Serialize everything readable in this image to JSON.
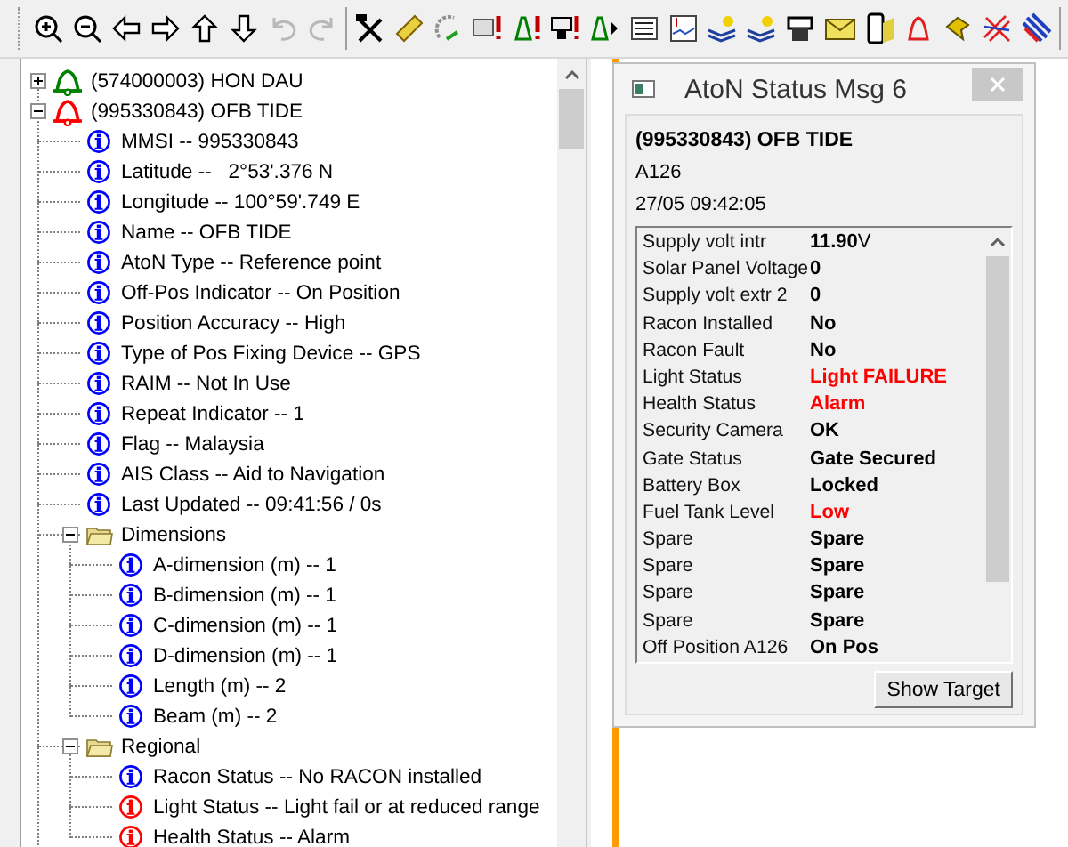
{
  "toolbar": {
    "groups": [
      [
        {
          "kind": "zoom-in",
          "disabled": false
        },
        {
          "kind": "zoom-out",
          "disabled": false
        },
        {
          "kind": "left",
          "disabled": false
        },
        {
          "kind": "right",
          "disabled": false
        },
        {
          "kind": "up",
          "disabled": false
        },
        {
          "kind": "down",
          "disabled": false
        },
        {
          "kind": "undo",
          "disabled": true
        },
        {
          "kind": "redo",
          "disabled": true
        }
      ],
      [
        {
          "kind": "tools",
          "disabled": false
        },
        {
          "kind": "ruler",
          "disabled": false
        },
        {
          "kind": "dish",
          "disabled": false
        },
        {
          "kind": "table-alert",
          "disabled": false
        },
        {
          "kind": "beacon-alert",
          "disabled": false
        },
        {
          "kind": "monitor-alert",
          "disabled": false
        },
        {
          "kind": "beacon-signal",
          "disabled": false
        },
        {
          "kind": "list",
          "disabled": false
        },
        {
          "kind": "chart",
          "disabled": false
        },
        {
          "kind": "layers-sun",
          "disabled": false
        },
        {
          "kind": "layers-sun",
          "disabled": false
        },
        {
          "kind": "printer",
          "disabled": false
        },
        {
          "kind": "envelope",
          "disabled": false
        },
        {
          "kind": "phone",
          "disabled": false
        },
        {
          "kind": "bell",
          "disabled": false
        },
        {
          "kind": "pin",
          "disabled": false
        },
        {
          "kind": "crossed-lines",
          "disabled": false
        },
        {
          "kind": "stripes",
          "disabled": false
        }
      ]
    ]
  },
  "tree": [
    {
      "label": "(574000003) HON DAU",
      "kind": "bell",
      "color": "#008000",
      "expanded": false
    },
    {
      "label": "(995330843) OFB TIDE",
      "kind": "bell",
      "color": "#ff0000",
      "expanded": true,
      "children": [
        {
          "label": "MMSI -- 995330843",
          "kind": "info",
          "color": "#0000ff"
        },
        {
          "label": "Latitude --   2°53'.376 N",
          "kind": "info",
          "color": "#0000ff"
        },
        {
          "label": "Longitude -- 100°59'.749 E",
          "kind": "info",
          "color": "#0000ff"
        },
        {
          "label": "Name -- OFB TIDE",
          "kind": "info",
          "color": "#0000ff"
        },
        {
          "label": "AtoN Type -- Reference point",
          "kind": "info",
          "color": "#0000ff"
        },
        {
          "label": "Off-Pos Indicator -- On Position",
          "kind": "info",
          "color": "#0000ff"
        },
        {
          "label": "Position Accuracy -- High",
          "kind": "info",
          "color": "#0000ff"
        },
        {
          "label": "Type of Pos Fixing Device -- GPS",
          "kind": "info",
          "color": "#0000ff"
        },
        {
          "label": "RAIM -- Not In Use",
          "kind": "info",
          "color": "#0000ff"
        },
        {
          "label": "Repeat Indicator -- 1",
          "kind": "info",
          "color": "#0000ff"
        },
        {
          "label": "Flag -- Malaysia",
          "kind": "info",
          "color": "#0000ff"
        },
        {
          "label": "AIS Class -- Aid to Navigation",
          "kind": "info",
          "color": "#0000ff"
        },
        {
          "label": "Last Updated -- 09:41:56 / 0s",
          "kind": "info",
          "color": "#0000ff"
        },
        {
          "label": "Dimensions",
          "kind": "folder",
          "expanded": true,
          "children": [
            {
              "label": "A-dimension (m) -- 1",
              "kind": "info",
              "color": "#0000ff"
            },
            {
              "label": "B-dimension (m) -- 1",
              "kind": "info",
              "color": "#0000ff"
            },
            {
              "label": "C-dimension (m) -- 1",
              "kind": "info",
              "color": "#0000ff"
            },
            {
              "label": "D-dimension (m) -- 1",
              "kind": "info",
              "color": "#0000ff"
            },
            {
              "label": "Length (m) -- 2",
              "kind": "info",
              "color": "#0000ff"
            },
            {
              "label": "Beam (m) -- 2",
              "kind": "info",
              "color": "#0000ff"
            }
          ]
        },
        {
          "label": "Regional",
          "kind": "folder",
          "expanded": true,
          "children": [
            {
              "label": "Racon Status -- No RACON installed",
              "kind": "info",
              "color": "#0000ff"
            },
            {
              "label": "Light Status -- Light fail or at reduced range",
              "kind": "info",
              "color": "#ff0000"
            },
            {
              "label": "Health Status -- Alarm",
              "kind": "info",
              "color": "#ff0000"
            }
          ]
        }
      ]
    }
  ],
  "dialog": {
    "title": "AtoN Status Msg 6",
    "target": "(995330843) OFB TIDE",
    "station": "A126",
    "time": "27/05 09:42:05",
    "rows": [
      {
        "label": "Supply volt intr",
        "value": "11.90",
        "unit": "V",
        "alert": false
      },
      {
        "label": "Solar Panel Voltage",
        "value": "0",
        "alert": false
      },
      {
        "label": "Supply volt extr 2",
        "value": "0",
        "alert": false
      },
      {
        "label": "Racon Installed",
        "value": "No",
        "alert": false
      },
      {
        "label": "Racon Fault",
        "value": "No",
        "alert": false
      },
      {
        "label": "Light Status",
        "value": "Light FAILURE",
        "alert": true
      },
      {
        "label": "Health Status",
        "value": "Alarm",
        "alert": true
      },
      {
        "label": "Security Camera",
        "value": "OK",
        "alert": false
      },
      {
        "label": "Gate Status",
        "value": "Gate Secured",
        "alert": false
      },
      {
        "label": "Battery Box",
        "value": "Locked",
        "alert": false
      },
      {
        "label": "Fuel Tank Level",
        "value": "Low",
        "alert": true
      },
      {
        "label": "Spare",
        "value": "Spare",
        "alert": false
      },
      {
        "label": "Spare",
        "value": "Spare",
        "alert": false
      },
      {
        "label": "Spare",
        "value": "Spare",
        "alert": false
      },
      {
        "label": "Spare",
        "value": "Spare",
        "alert": false
      },
      {
        "label": "Off Position A126",
        "value": "On Pos",
        "alert": false
      }
    ],
    "button": "Show Target"
  }
}
